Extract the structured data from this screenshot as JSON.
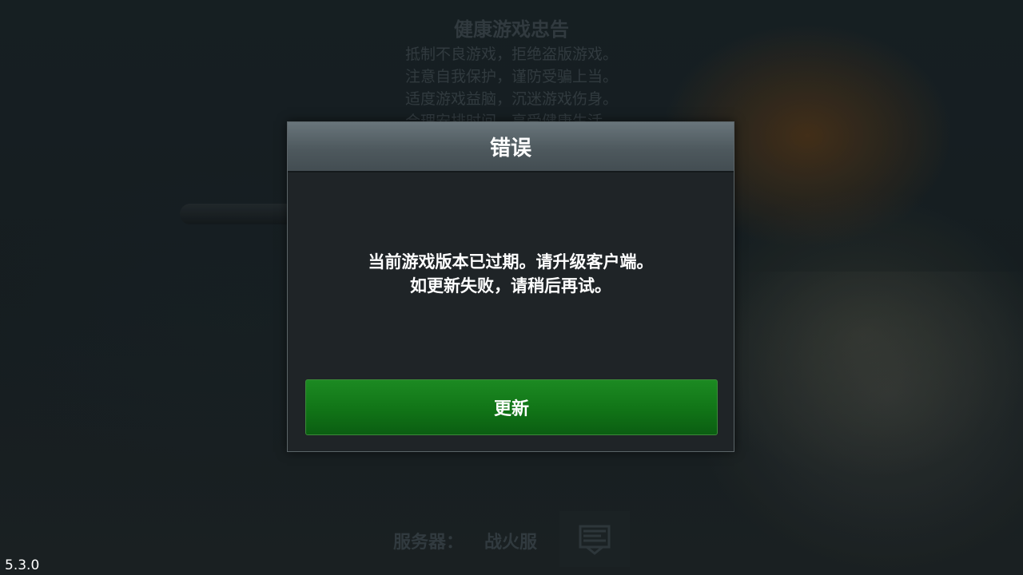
{
  "advisory": {
    "title": "健康游戏忠告",
    "lines": [
      "抵制不良游戏，拒绝盗版游戏。",
      "注意自我保护，谨防受骗上当。",
      "适度游戏益脑，沉迷游戏伤身。",
      "合理安排时间，享受健康生活。"
    ]
  },
  "dialog": {
    "title": "错误",
    "message": [
      "当前游戏版本已过期。请升级客户端。",
      "如更新失败，请稍后再试。"
    ],
    "button_label": "更新"
  },
  "server": {
    "label": "服务器：",
    "name": "战火服",
    "icon": "server-flag-icon"
  },
  "version": "5.3.0",
  "colors": {
    "button_green": "#117417",
    "header_gray": "#4e595e",
    "dialog_bg": "#1f2427"
  }
}
